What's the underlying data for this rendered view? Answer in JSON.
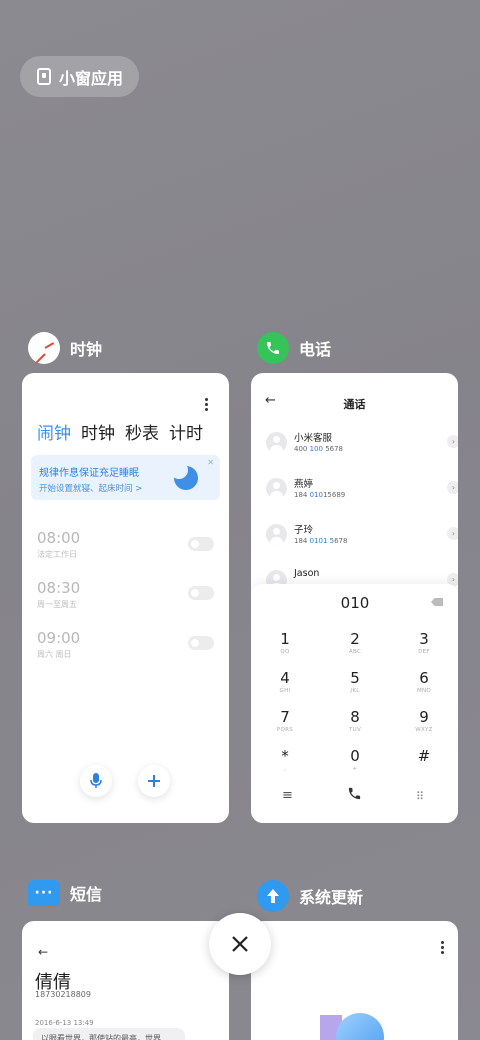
{
  "floating_window": {
    "label": "小窗应用"
  },
  "clock_app": {
    "name": "时钟",
    "tabs": [
      "闹钟",
      "时钟",
      "秒表",
      "计时"
    ],
    "banner": {
      "title": "规律作息保证充足睡眠",
      "subtitle": "开始设置就寝、起床时间 >"
    },
    "alarms": [
      {
        "time": "08:00",
        "repeat": "法定工作日"
      },
      {
        "time": "08:30",
        "repeat": "周一至周五"
      },
      {
        "time": "09:00",
        "repeat": "周六 周日"
      }
    ],
    "colors": {
      "accent": "#3b8ff0",
      "icon_hand": "#e64a3b"
    }
  },
  "phone_app": {
    "name": "电话",
    "title": "通话",
    "contacts": [
      {
        "name": "小米客服",
        "number_pre": "400 ",
        "number_hl": "100",
        "number_post": " 5678"
      },
      {
        "name": "燕婷",
        "number_pre": "184 ",
        "number_hl": "010",
        "number_post": "15689"
      },
      {
        "name": "子玲",
        "number_pre": "184 ",
        "number_hl": "0101",
        "number_post": " 5678"
      },
      {
        "name": "Jason",
        "number_pre": "",
        "number_hl": "",
        "number_post": ""
      }
    ],
    "dial_entry": "010",
    "keys": [
      {
        "d": "1",
        "l": "QQ"
      },
      {
        "d": "2",
        "l": "ABC"
      },
      {
        "d": "3",
        "l": "DEF"
      },
      {
        "d": "4",
        "l": "GHI"
      },
      {
        "d": "5",
        "l": "JKL"
      },
      {
        "d": "6",
        "l": "MNO"
      },
      {
        "d": "7",
        "l": "PQRS"
      },
      {
        "d": "8",
        "l": "TUV"
      },
      {
        "d": "9",
        "l": "WXYZ"
      },
      {
        "d": "*",
        "l": ","
      },
      {
        "d": "0",
        "l": "+"
      },
      {
        "d": "#",
        "l": ""
      }
    ],
    "colors": {
      "icon_bg": "#35c35a",
      "highlight": "#2d7fe0"
    }
  },
  "sms_app": {
    "name": "短信",
    "contact_name": "倩倩",
    "contact_number": "18730218809",
    "date": "2016-6-13 13:49",
    "preview": "以眼看世界，那使站的最高，世界",
    "colors": {
      "icon_bg": "#2f9af0"
    }
  },
  "update_app": {
    "name": "系统更新",
    "colors": {
      "icon_bg": "#2f9af0"
    }
  }
}
